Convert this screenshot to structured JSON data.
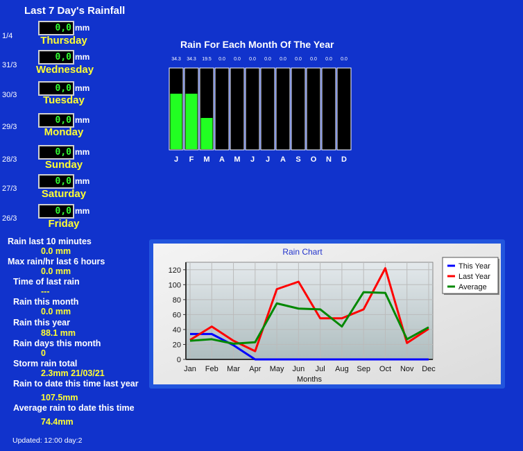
{
  "page": {
    "title": "Last 7 Day's Rainfall",
    "updated": "Updated: 12:00 day:2"
  },
  "days": [
    {
      "date": "1/4",
      "value": "0,0",
      "unit": "mm",
      "name": "Thursday"
    },
    {
      "date": "31/3",
      "value": "0,0",
      "unit": "mm",
      "name": "Wednesday"
    },
    {
      "date": "30/3",
      "value": "0,0",
      "unit": "mm",
      "name": "Tuesday"
    },
    {
      "date": "29/3",
      "value": "0,0",
      "unit": "mm",
      "name": "Monday"
    },
    {
      "date": "28/3",
      "value": "0,0",
      "unit": "mm",
      "name": "Sunday"
    },
    {
      "date": "27/3",
      "value": "0,0",
      "unit": "mm",
      "name": "Saturday"
    },
    {
      "date": "26/3",
      "value": "0,0",
      "unit": "mm",
      "name": "Friday"
    }
  ],
  "stats": {
    "rain_10min_label": "Rain last 10 minutes",
    "rain_10min_value": "0.0 mm",
    "max_rate_label": "Max rain/hr last 6 hours",
    "max_rate_value": "0.0 mm",
    "last_rain_label": "Time of last rain",
    "last_rain_value": "---",
    "month_label": "Rain this month",
    "month_value": "0.0 mm",
    "year_label": "Rain this year",
    "year_value": "88.1 mm",
    "raindays_label": "Rain days this month",
    "raindays_value": "0",
    "storm_label": "Storm rain total",
    "storm_value": "2.3mm 21/03/21",
    "todate_last_label": "Rain to date this time last year",
    "todate_last_value": "107.5mm",
    "avg_todate_label": "Average rain to date this time",
    "avg_todate_value": "74.4mm"
  },
  "colors": {
    "background": "#1133cc",
    "lcd_text": "#33ff33",
    "bar_fill": "#22ff22",
    "highlight_text": "#ffff33"
  },
  "chart_data": [
    {
      "type": "bar",
      "title": "Rain For Each Month Of The Year",
      "categories": [
        "J",
        "F",
        "M",
        "A",
        "M",
        "J",
        "J",
        "A",
        "S",
        "O",
        "N",
        "D"
      ],
      "values": [
        34.3,
        34.3,
        19.5,
        0.0,
        0.0,
        0.0,
        0.0,
        0.0,
        0.0,
        0.0,
        0.0,
        0.0
      ],
      "value_labels": [
        "34.3",
        "34.3",
        "19.5",
        "0.0",
        "0.0",
        "0.0",
        "0.0",
        "0.0",
        "0.0",
        "0.0",
        "0.0",
        "0.0"
      ],
      "ylim": [
        0,
        50
      ]
    },
    {
      "type": "line",
      "title": "Rain Chart",
      "xlabel": "Months",
      "ylabel": "",
      "categories": [
        "Jan",
        "Feb",
        "Mar",
        "Apr",
        "May",
        "Jun",
        "Jul",
        "Aug",
        "Sep",
        "Oct",
        "Nov",
        "Dec"
      ],
      "ylim": [
        0,
        130
      ],
      "yticks": [
        0,
        20,
        40,
        60,
        80,
        100,
        120
      ],
      "grid": true,
      "legend": "top-right",
      "series": [
        {
          "name": "This Year",
          "color": "#0000ff",
          "values": [
            34,
            34,
            19,
            0,
            0,
            0,
            0,
            0,
            0,
            0,
            0,
            0
          ]
        },
        {
          "name": "Last Year",
          "color": "#ff0000",
          "values": [
            26,
            44,
            25,
            11,
            94,
            104,
            55,
            55,
            67,
            122,
            22,
            41
          ]
        },
        {
          "name": "Average",
          "color": "#008800",
          "values": [
            25,
            27,
            21,
            23,
            75,
            68,
            67,
            44,
            90,
            89,
            27,
            43
          ]
        }
      ]
    }
  ]
}
